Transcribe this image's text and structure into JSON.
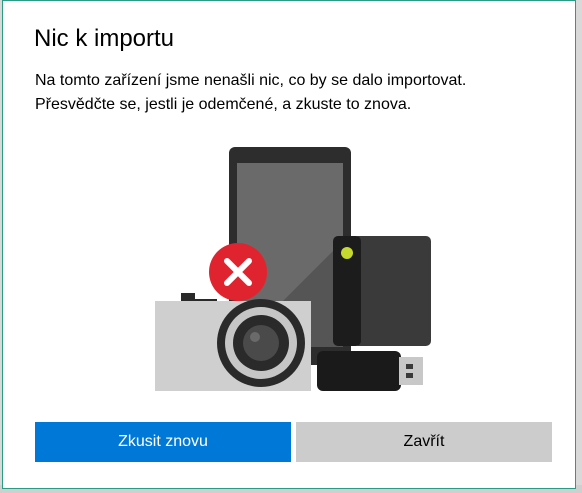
{
  "dialog": {
    "title": "Nic k importu",
    "message_line1": "Na tomto zařízení jsme nenašli nic, co by se dalo importovat.",
    "message_line2": "Přesvědčte se, jestli je odemčené, a zkuste to znova.",
    "illustration": {
      "icons": [
        "phone-icon",
        "external-drive-icon",
        "camera-icon",
        "usb-stick-icon",
        "error-badge-icon"
      ],
      "error_color": "#e0242f",
      "drive_led_color": "#c5d82e"
    },
    "buttons": {
      "retry_label": "Zkusit znovu",
      "close_label": "Zavřít"
    },
    "colors": {
      "accent": "#0078d7",
      "border": "#2b9c84",
      "secondary_button": "#cccccc"
    }
  }
}
